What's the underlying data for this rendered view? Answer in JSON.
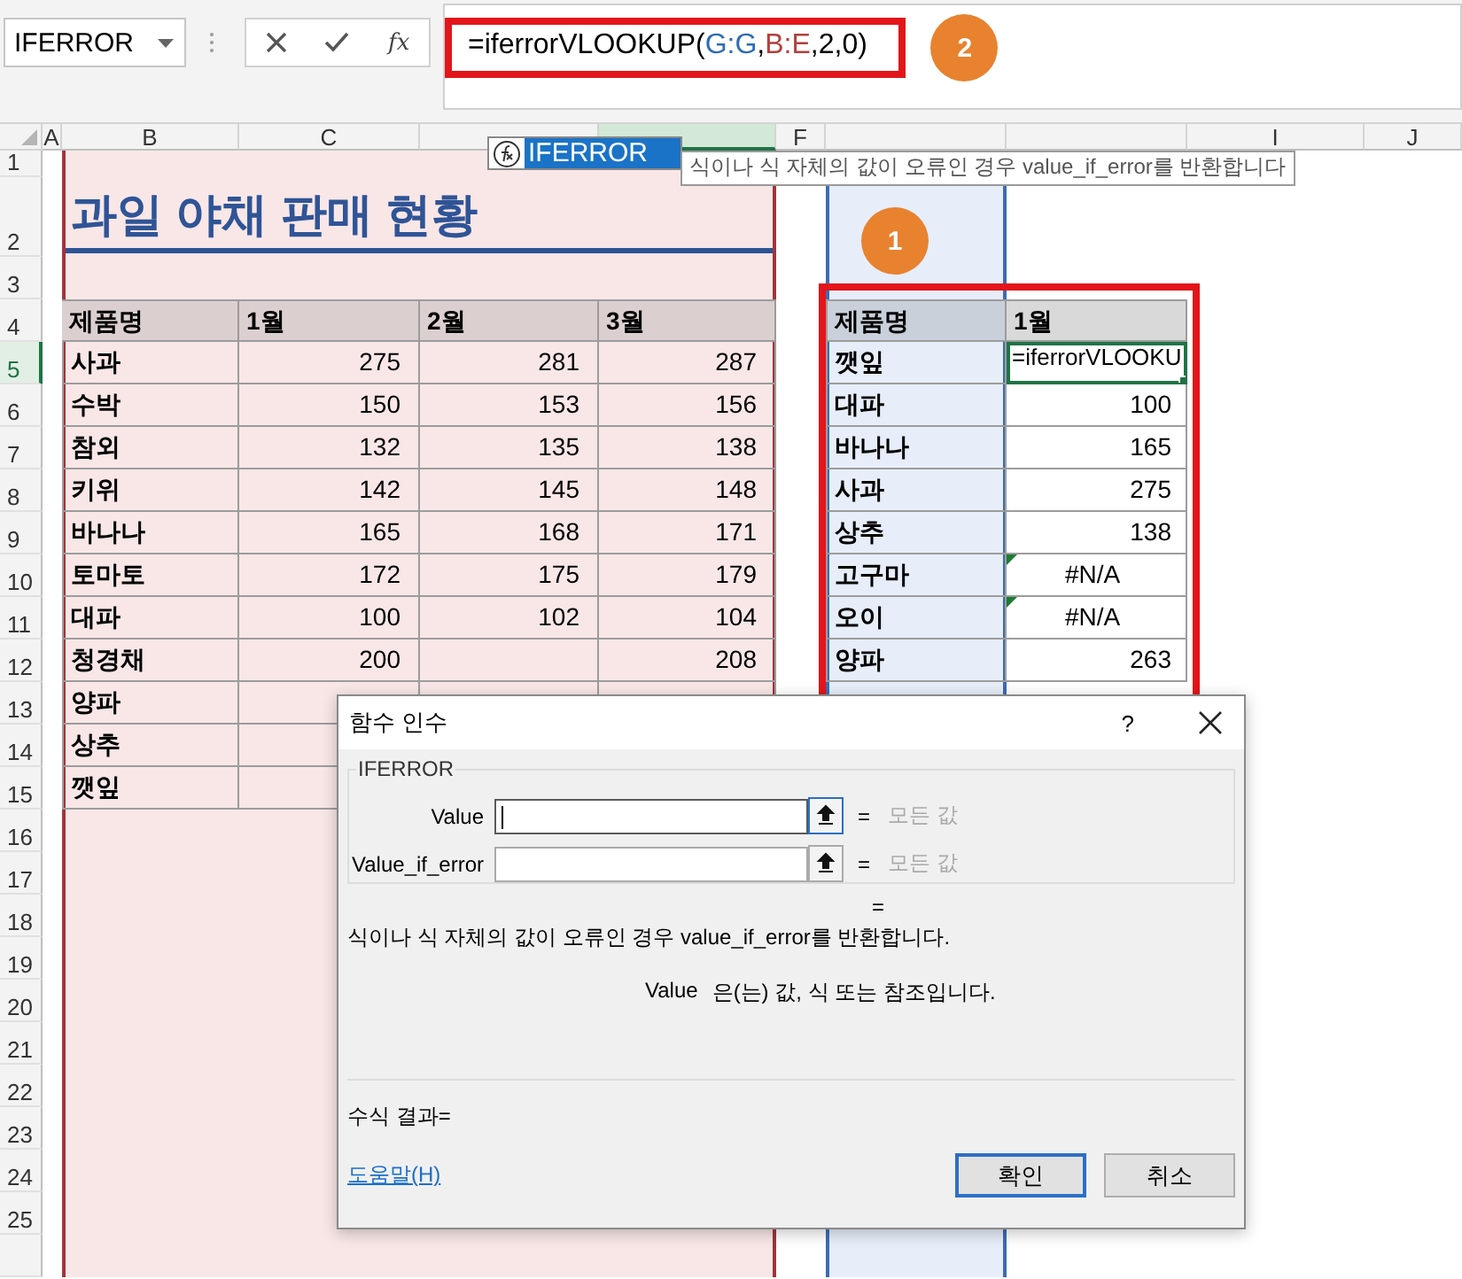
{
  "formula_bar": {
    "name_box": "IFERROR",
    "fx": "fx",
    "formula_parts": [
      {
        "text": "=iferrorVLOOKUP(",
        "color": "#000000"
      },
      {
        "text": "G:G",
        "color": "#2e6db4"
      },
      {
        "text": ",",
        "color": "#000000"
      },
      {
        "text": "B:E",
        "color": "#b0413e"
      },
      {
        "text": ",2,0)",
        "color": "#000000"
      }
    ],
    "badge": "2"
  },
  "autocomplete": {
    "function": "IFERROR",
    "tooltip": "식이나 식 자체의 값이 오류인 경우 value_if_error를 반환합니다"
  },
  "sheet": {
    "columns": [
      {
        "label": "A",
        "selected": false
      },
      {
        "label": "B",
        "selected": false
      },
      {
        "label": "C",
        "selected": false
      },
      {
        "selected": false
      },
      {
        "selected": true
      },
      {
        "label": "F",
        "selected": false
      },
      {
        "selected": false
      },
      {
        "selected": false
      },
      {
        "label": "I",
        "selected": false
      },
      {
        "label": "J",
        "selected": false
      }
    ],
    "rows": [
      {
        "number": "1",
        "selected": false
      },
      {
        "number": "2",
        "selected": false
      },
      {
        "number": "3",
        "selected": false
      },
      {
        "number": "4",
        "selected": false
      },
      {
        "number": "5",
        "selected": true
      },
      {
        "number": "6",
        "selected": false
      },
      {
        "number": "7",
        "selected": false
      },
      {
        "number": "8",
        "selected": false
      },
      {
        "number": "9",
        "selected": false
      },
      {
        "number": "10",
        "selected": false
      },
      {
        "number": "11",
        "selected": false
      },
      {
        "number": "12",
        "selected": false
      },
      {
        "number": "13",
        "selected": false
      },
      {
        "number": "14",
        "selected": false
      },
      {
        "number": "15",
        "selected": false
      },
      {
        "number": "16",
        "selected": false
      },
      {
        "number": "17",
        "selected": false
      },
      {
        "number": "18",
        "selected": false
      },
      {
        "number": "19",
        "selected": false
      },
      {
        "number": "20",
        "selected": false
      },
      {
        "number": "21",
        "selected": false
      },
      {
        "number": "22",
        "selected": false
      },
      {
        "number": "23",
        "selected": false
      },
      {
        "number": "24",
        "selected": false
      },
      {
        "number": "25",
        "selected": false
      }
    ],
    "title": "과일 야채 판매 현황",
    "left_table": {
      "header": [
        "제품명",
        "1월",
        "2월",
        "3월"
      ],
      "rows": [
        {
          "name": "사과",
          "m1": "275",
          "m2": "281",
          "m3": "287"
        },
        {
          "name": "수박",
          "m1": "150",
          "m2": "153",
          "m3": "156"
        },
        {
          "name": "참외",
          "m1": "132",
          "m2": "135",
          "m3": "138"
        },
        {
          "name": "키위",
          "m1": "142",
          "m2": "145",
          "m3": "148"
        },
        {
          "name": "바나나",
          "m1": "165",
          "m2": "168",
          "m3": "171"
        },
        {
          "name": "토마토",
          "m1": "172",
          "m2": "175",
          "m3": "179"
        },
        {
          "name": "대파",
          "m1": "100",
          "m2": "102",
          "m3": "104"
        },
        {
          "name": "청경채",
          "m1": "200",
          "m3": "208"
        },
        {
          "name": "양파"
        },
        {
          "name": "상추"
        },
        {
          "name": "깻잎"
        }
      ]
    },
    "right_table": {
      "badge": "1",
      "header": [
        "제품명",
        "1월"
      ],
      "rows": [
        {
          "name": "깻잎",
          "value": "=iferrorVLOOKU",
          "kind": "formula",
          "selected": true
        },
        {
          "name": "대파",
          "value": "100",
          "kind": "number",
          "selected": false
        },
        {
          "name": "바나나",
          "value": "165",
          "kind": "number",
          "selected": false
        },
        {
          "name": "사과",
          "value": "275",
          "kind": "number",
          "selected": false
        },
        {
          "name": "상추",
          "value": "138",
          "kind": "number",
          "selected": false
        },
        {
          "name": "고구마",
          "value": "#N/A",
          "kind": "error",
          "selected": false
        },
        {
          "name": "오이",
          "value": "#N/A",
          "kind": "error",
          "selected": false
        },
        {
          "name": "양파",
          "value": "263",
          "kind": "number",
          "selected": false
        }
      ]
    }
  },
  "dialog": {
    "title": "함수 인수",
    "help": "?",
    "group": "IFERROR",
    "args": [
      {
        "label": "Value",
        "equals": "=",
        "hint": "모든 값",
        "focused": true
      },
      {
        "label": "Value_if_error",
        "equals": "=",
        "hint": "모든 값",
        "focused": false
      }
    ],
    "result_equals": "=",
    "description": "식이나 식 자체의 값이 오류인 경우 value_if_error를 반환합니다.",
    "arg_name": "Value",
    "arg_description": "은(는) 값, 식 또는 참조입니다.",
    "formula_result": "수식 결과=",
    "help_link": "도움말(H)",
    "buttons": [
      {
        "label": "확인",
        "default": true
      },
      {
        "label": "취소",
        "default": false
      }
    ]
  }
}
